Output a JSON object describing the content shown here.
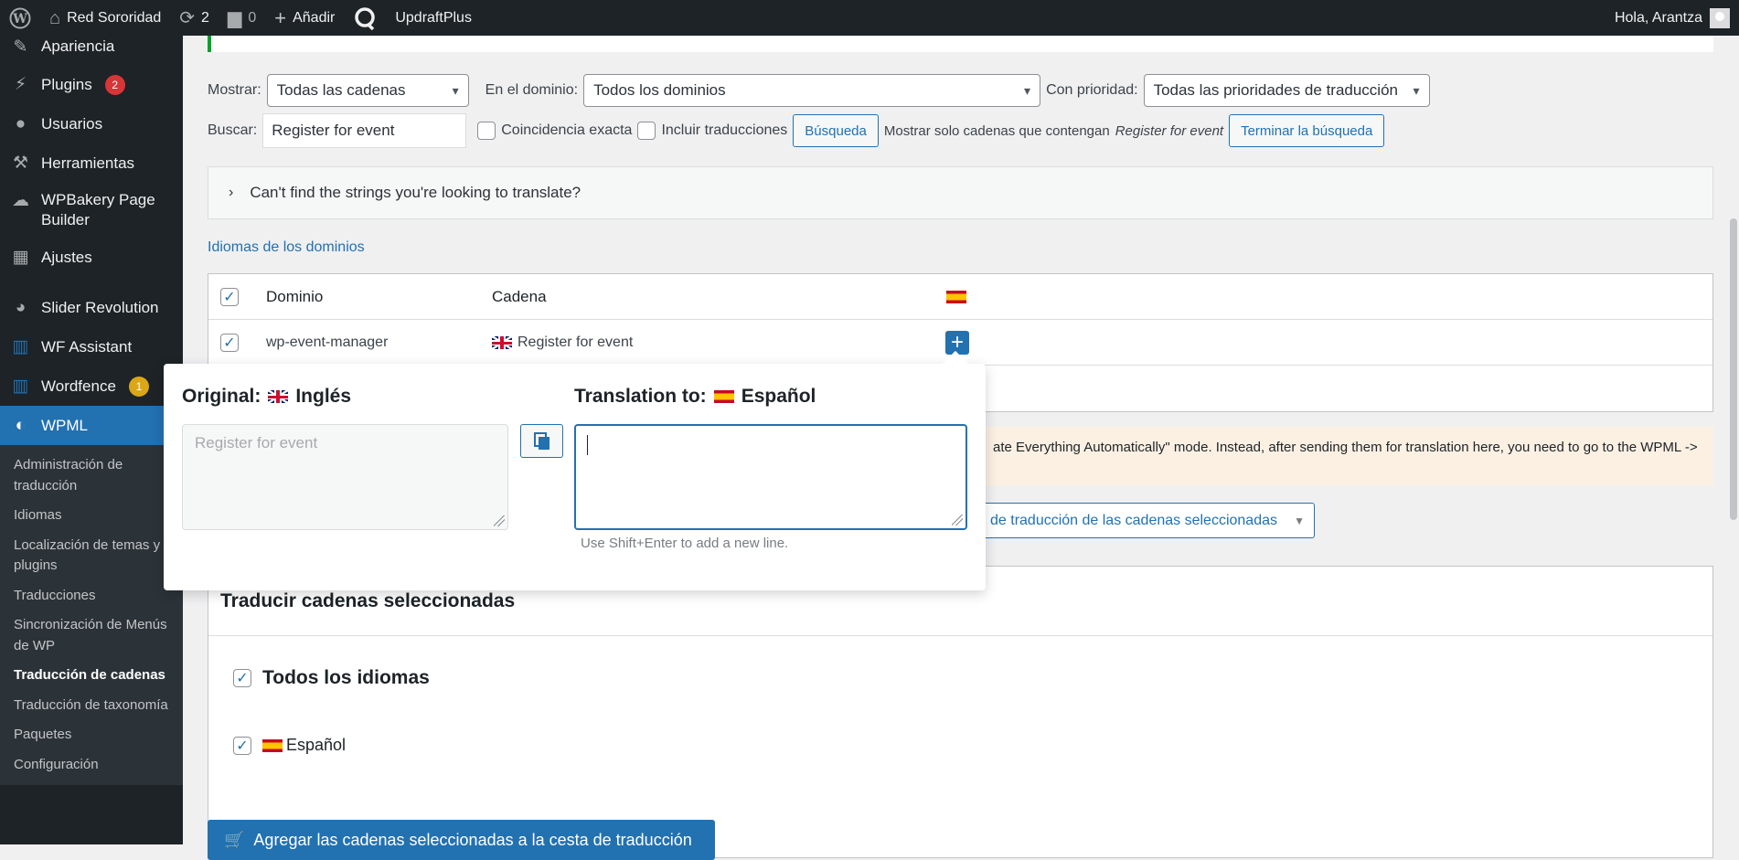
{
  "adminbar": {
    "site_name": "Red Sororidad",
    "updates_count": "2",
    "comments_count": "0",
    "add_new": "Añadir",
    "plugin": "UpdraftPlus",
    "greeting": "Hola, Arantza"
  },
  "sidebar": {
    "items": [
      {
        "label": "Apariencia"
      },
      {
        "label": "Plugins",
        "badge": "2"
      },
      {
        "label": "Usuarios"
      },
      {
        "label": "Herramientas"
      },
      {
        "label": "WPBakery Page Builder"
      },
      {
        "label": "Ajustes"
      },
      {
        "label": "Slider Revolution"
      },
      {
        "label": "WF Assistant"
      },
      {
        "label": "Wordfence",
        "badge": "1"
      },
      {
        "label": "WPML"
      }
    ],
    "submenu": [
      "Administración de traducción",
      "Idiomas",
      "Localización de temas y plugins",
      "Traducciones",
      "Sincronización de Menús de WP",
      "Traducción de cadenas",
      "Traducción de taxonomía",
      "Paquetes",
      "Configuración"
    ]
  },
  "filters": {
    "show_label": "Mostrar:",
    "show_value": "Todas las cadenas",
    "domain_label": "En el dominio:",
    "domain_value": "Todos los dominios",
    "priority_label": "Con prioridad:",
    "priority_value": "Todas las prioridades de traducción",
    "search_label": "Buscar:",
    "search_value": "Register for event",
    "exact_match": "Coincidencia exacta",
    "include_translations": "Incluir traducciones",
    "search_button": "Búsqueda",
    "showing_prefix": "Mostrar solo cadenas que contengan",
    "showing_term": "Register for event",
    "end_search_button": "Terminar la búsqueda"
  },
  "cant_find": "Can't find the strings you're looking to translate?",
  "domain_languages_link": "Idiomas de los dominios",
  "table": {
    "headers": {
      "domain": "Dominio",
      "string": "Cadena"
    },
    "rows": [
      {
        "domain": "wp-event-manager",
        "string": "Register for event"
      }
    ]
  },
  "warning_text": "ate Everything Automatically\" mode. Instead, after sending them for translation here, you need to go to the WPML ->",
  "priority_select": "de traducción de las cadenas seleccionadas",
  "translate_panel": {
    "title": "Traducir cadenas seleccionadas",
    "all_languages": "Todos los idiomas",
    "spanish": "Español",
    "add_button": "Agregar las cadenas seleccionadas a la cesta de traducción"
  },
  "popup": {
    "original_label": "Original:",
    "original_lang": "Inglés",
    "translation_label": "Translation to:",
    "translation_lang": "Español",
    "original_text": "Register for event",
    "hint": "Use Shift+Enter to add a new line."
  },
  "colors": {
    "admin_dark": "#1d2327",
    "accent": "#2271b1",
    "notice_green": "#00a32a",
    "warning_bg": "#fcf0e3"
  }
}
